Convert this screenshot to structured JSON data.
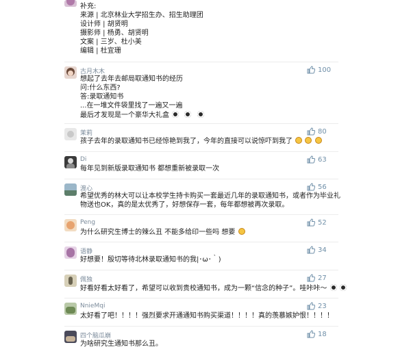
{
  "colors": {
    "username": "#7a8a9a",
    "like": "#6f8fa8",
    "text": "#222222",
    "divider": "#ececec"
  },
  "top_comment": {
    "lines": [
      "补充:",
      "来源 | 北京林业大学招生办、招生助理团",
      "设计师 | 胡贤明",
      "摄影师 | 杨勇、胡贤明",
      "文案 | 三岁、杜小美",
      "编辑 | 杜宜珊"
    ]
  },
  "comments": [
    {
      "username": "古月木木",
      "likes": "100",
      "avatar_icon": "girl-avatar-icon",
      "lines": [
        "想起了去年去邮局取通知书的经历",
        "问:什么东西?",
        "答:录取通知书",
        "...在一堆文件袋里找了一遍又一遍",
        "最后才发现是一个豪华大礼盒"
      ],
      "emoji": [
        "grimace-emoji-icon",
        "grimace-emoji-icon",
        "grimace-emoji-icon"
      ]
    },
    {
      "username": "茉莉",
      "likes": "80",
      "avatar_icon": "flower-avatar-icon",
      "lines": [
        "孩子去年的录取通知书已经惊艳到我了，今年的直接可以说惊吓到我了"
      ],
      "emoji": [
        "laughing-emoji-icon",
        "laughing-emoji-icon",
        "laughing-emoji-icon"
      ]
    },
    {
      "username": "Di",
      "likes": "63",
      "avatar_icon": "person-avatar-icon",
      "lines": [
        "每年见到新版录取通知书 都想重新被录取一次"
      ],
      "emoji": []
    },
    {
      "username": "渡心",
      "likes": "56",
      "avatar_icon": "landscape-avatar-icon",
      "lines": [
        "希望优秀的林大可以让本校学生持卡购买一套最近几年的录取通知书，或者作为毕业礼",
        "物送也OK，真的是太优秀了，好想保存一套，每年都想被再次录取。"
      ],
      "emoji": []
    },
    {
      "username": "Peng",
      "likes": "52",
      "avatar_icon": "cartoon-avatar-icon",
      "lines": [
        "为什么研究生博士的辣么丑 不能多给印一些吗 想要"
      ],
      "emoji": [
        "laughing-emoji-icon"
      ]
    },
    {
      "username": "语静",
      "likes": "34",
      "avatar_icon": "anime-avatar-icon",
      "lines": [
        "好想要！殷切等待北林录取通知书的我|･ω･｀)"
      ],
      "emoji": []
    },
    {
      "username": "佩独",
      "likes": "27",
      "avatar_icon": "figure-avatar-icon",
      "lines": [
        "好看好看太好看了，希望可以收到贵校通知书，成为一颗“信念的种子”。哇咔咔～"
      ],
      "emoji": [
        "grimace-emoji-icon",
        "grimace-emoji-icon"
      ]
    },
    {
      "username": "NnieMqi",
      "likes": "23",
      "avatar_icon": "nature-avatar-icon",
      "lines": [
        "太好看了吧！！！！强烈要求开通通知书购买渠道！！！！真的羡慕嫉妒恨！！！！"
      ],
      "emoji": []
    },
    {
      "username": "四个脑瓜崩",
      "likes": "18",
      "avatar_icon": "group-avatar-icon",
      "lines": [
        "为啥研究生通知书那么丑。"
      ],
      "emoji": []
    }
  ]
}
